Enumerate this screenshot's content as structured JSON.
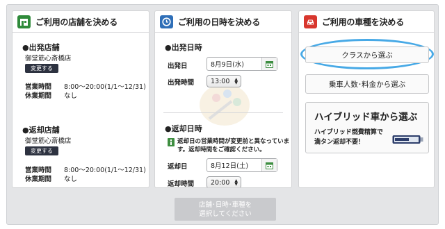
{
  "store_panel": {
    "title": "ご利用の店舗を決める",
    "departure": {
      "heading": "●出発店舗",
      "store_name": "御堂筋心斎橋店",
      "change_label": "変更する",
      "hours_label": "営業時間",
      "hours_value": "8:00〜20:00(1/1〜12/31)",
      "closed_label": "休業期間",
      "closed_value": "なし"
    },
    "return": {
      "heading": "●返却店舗",
      "store_name": "御堂筋心斎橋店",
      "change_label": "変更する",
      "hours_label": "営業時間",
      "hours_value": "8:00〜20:00(1/1〜12/31)",
      "closed_label": "休業期間",
      "closed_value": "なし"
    }
  },
  "datetime_panel": {
    "title": "ご利用の日時を決める",
    "departure": {
      "heading": "●出発日時",
      "date_label": "出発日",
      "date_value": "8月9日(水)",
      "time_label": "出発時間",
      "time_value": "13:00"
    },
    "return": {
      "heading": "●返却日時",
      "notice_line1": "返却日の営業時間が変更前と異なっていま",
      "notice_line2": "す。返却時間をご確認ください。",
      "date_label": "返却日",
      "date_value": "8月12日(土)",
      "time_label": "返却時間",
      "time_value": "20:00"
    }
  },
  "vehicle_panel": {
    "title": "ご利用の車種を決める",
    "class_button": "クラスから選ぶ",
    "capacity_button": "乗車人数･料金から選ぶ",
    "hybrid_title": "ハイブリッド車から選ぶ",
    "hybrid_sub1": "ハイブリッド燃費精算で",
    "hybrid_sub2": "満タン返却不要！"
  },
  "submit": {
    "line1": "店舗･日時･車種を",
    "line2": "選択してください"
  },
  "colors": {
    "store_icon": "#2f8a3a",
    "datetime_icon": "#2f6fb8",
    "vehicle_icon": "#d8372e",
    "highlight_ring": "#47a9e6"
  }
}
